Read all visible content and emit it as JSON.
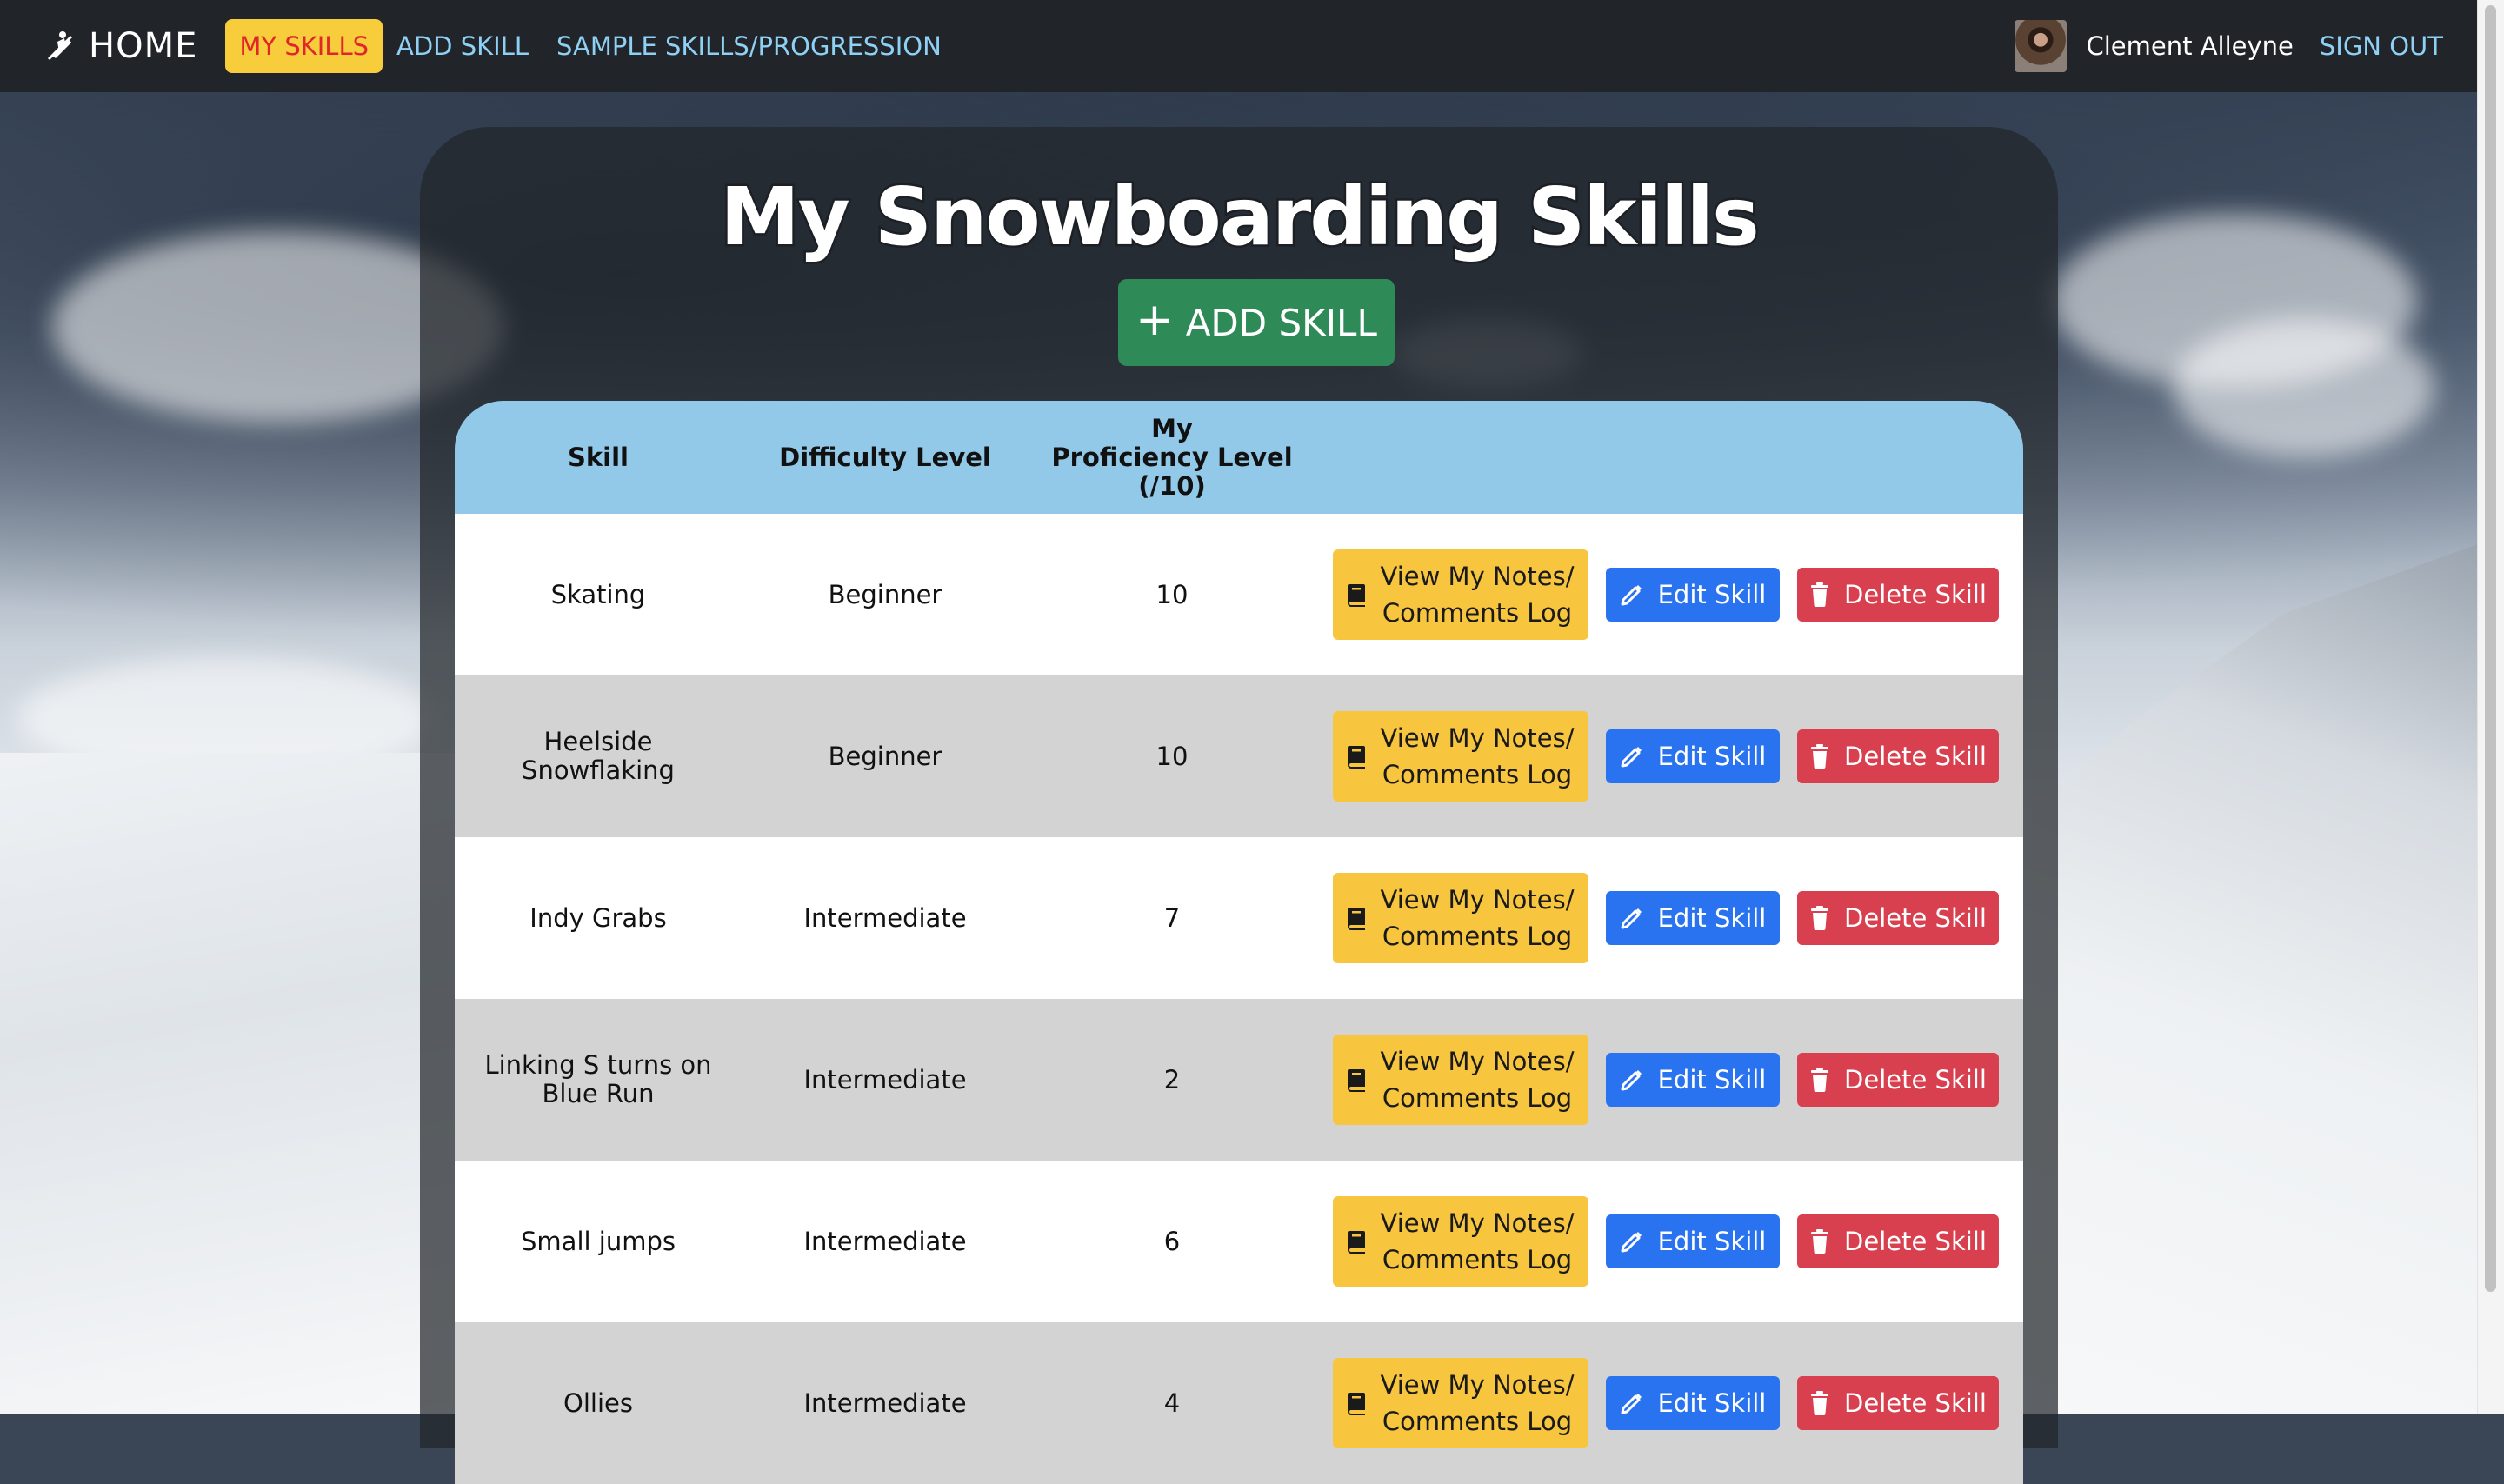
{
  "navbar": {
    "brand": "HOME",
    "links": [
      {
        "label": "MY SKILLS",
        "active": true
      },
      {
        "label": "ADD SKILL",
        "active": false
      },
      {
        "label": "SAMPLE SKILLS/PROGRESSION",
        "active": false
      }
    ],
    "user_name": "Clement Alleyne",
    "sign_out": "SIGN OUT"
  },
  "page": {
    "title": "My Snowboarding Skills",
    "add_button": "ADD SKILL"
  },
  "table": {
    "headers": {
      "skill": "Skill",
      "difficulty": "Difficulty Level",
      "proficiency_line1": "My",
      "proficiency_line2": "Proficiency Level",
      "proficiency_line3": "(/10)"
    },
    "actions": {
      "notes_line1": "View My Notes/",
      "notes_line2": "Comments Log",
      "edit": "Edit Skill",
      "delete": "Delete Skill"
    },
    "rows": [
      {
        "skill": "Skating",
        "difficulty": "Beginner",
        "proficiency": "10"
      },
      {
        "skill": "Heelside Snowflaking",
        "difficulty": "Beginner",
        "proficiency": "10"
      },
      {
        "skill": "Indy Grabs",
        "difficulty": "Intermediate",
        "proficiency": "7"
      },
      {
        "skill": "Linking S turns on Blue Run",
        "difficulty": "Intermediate",
        "proficiency": "2"
      },
      {
        "skill": "Small jumps",
        "difficulty": "Intermediate",
        "proficiency": "6"
      },
      {
        "skill": "Ollies",
        "difficulty": "Intermediate",
        "proficiency": "4"
      }
    ]
  },
  "colors": {
    "navbar_bg": "#212529",
    "nav_link": "#8fd0f5",
    "active_link_bg": "#f8cd3c",
    "active_link_text": "#e0262b",
    "add_button": "#2e8b57",
    "table_header": "#92c9e9",
    "row_alt": "#d3d3d3",
    "notes_button": "#f7c53e",
    "edit_button": "#2a73f0",
    "delete_button": "#d9404f"
  },
  "icons": [
    "snowboarder-icon",
    "plus-icon",
    "book-icon",
    "pencil-icon",
    "trash-icon",
    "user-avatar"
  ]
}
